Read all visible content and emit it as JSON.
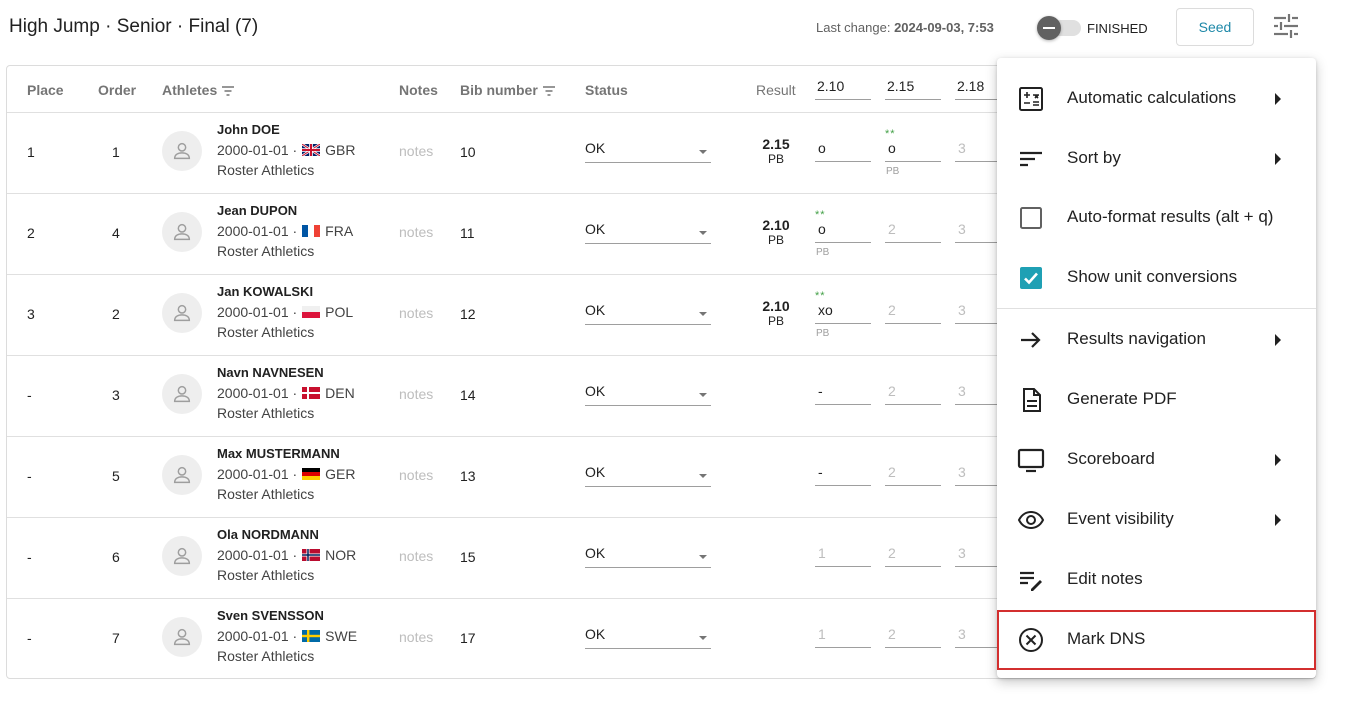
{
  "header": {
    "title": "High Jump · Senior · Final (7)",
    "last_change_label": "Last change:",
    "last_change_value": "2024-09-03, 7:53",
    "finished_label": "FINISHED",
    "seed_label": "Seed"
  },
  "table": {
    "headers": {
      "place": "Place",
      "order": "Order",
      "athletes": "Athletes",
      "notes": "Notes",
      "bib": "Bib number",
      "status": "Status",
      "result": "Result"
    },
    "heights": [
      "2.10",
      "2.15",
      "2.18"
    ],
    "rows": [
      {
        "place": "1",
        "order": "1",
        "name": "John DOE",
        "dob": "2000-01-01 ·",
        "country": "GBR",
        "club": "Roster Athletics",
        "notes": "notes",
        "bib": "10",
        "status": "OK",
        "result": "2.15",
        "result_pb": "PB",
        "a1": "o",
        "a1_stars": "",
        "a1_pb": "",
        "a2": "o",
        "a2_stars": "**",
        "a2_pb": "PB",
        "a3": "3"
      },
      {
        "place": "2",
        "order": "4",
        "name": "Jean DUPON",
        "dob": "2000-01-01 ·",
        "country": "FRA",
        "club": "Roster Athletics",
        "notes": "notes",
        "bib": "11",
        "status": "OK",
        "result": "2.10",
        "result_pb": "PB",
        "a1": "o",
        "a1_stars": "**",
        "a1_pb": "PB",
        "a2": "2",
        "a2_stars": "",
        "a2_pb": "",
        "a3": "3"
      },
      {
        "place": "3",
        "order": "2",
        "name": "Jan KOWALSKI",
        "dob": "2000-01-01 ·",
        "country": "POL",
        "club": "Roster Athletics",
        "notes": "notes",
        "bib": "12",
        "status": "OK",
        "result": "2.10",
        "result_pb": "PB",
        "a1": "xo",
        "a1_stars": "**",
        "a1_pb": "PB",
        "a2": "2",
        "a2_stars": "",
        "a2_pb": "",
        "a3": "3"
      },
      {
        "place": "-",
        "order": "3",
        "name": "Navn NAVNESEN",
        "dob": "2000-01-01 ·",
        "country": "DEN",
        "club": "Roster Athletics",
        "notes": "notes",
        "bib": "14",
        "status": "OK",
        "result": "",
        "result_pb": "",
        "a1": "-",
        "a1_stars": "",
        "a1_pb": "",
        "a2": "2",
        "a2_stars": "",
        "a2_pb": "",
        "a3": "3"
      },
      {
        "place": "-",
        "order": "5",
        "name": "Max MUSTERMANN",
        "dob": "2000-01-01 ·",
        "country": "GER",
        "club": "Roster Athletics",
        "notes": "notes",
        "bib": "13",
        "status": "OK",
        "result": "",
        "result_pb": "",
        "a1": "-",
        "a1_stars": "",
        "a1_pb": "",
        "a2": "2",
        "a2_stars": "",
        "a2_pb": "",
        "a3": "3"
      },
      {
        "place": "-",
        "order": "6",
        "name": "Ola NORDMANN",
        "dob": "2000-01-01 ·",
        "country": "NOR",
        "club": "Roster Athletics",
        "notes": "notes",
        "bib": "15",
        "status": "OK",
        "result": "",
        "result_pb": "",
        "a1": "1",
        "a1_stars": "",
        "a1_pb": "",
        "a2": "2",
        "a2_stars": "",
        "a2_pb": "",
        "a3": "3"
      },
      {
        "place": "-",
        "order": "7",
        "name": "Sven SVENSSON",
        "dob": "2000-01-01 ·",
        "country": "SWE",
        "club": "Roster Athletics",
        "notes": "notes",
        "bib": "17",
        "status": "OK",
        "result": "",
        "result_pb": "",
        "a1": "1",
        "a1_stars": "",
        "a1_pb": "",
        "a2": "2",
        "a2_stars": "",
        "a2_pb": "",
        "a3": "3"
      }
    ]
  },
  "menu": {
    "items": [
      {
        "label": "Automatic calculations",
        "icon": "calculator-icon",
        "submenu": true
      },
      {
        "label": "Sort by",
        "icon": "sort-icon",
        "submenu": true
      },
      {
        "label": "Auto-format results (alt + q)",
        "icon": "checkbox-unchecked-icon",
        "submenu": false
      },
      {
        "label": "Show unit conversions",
        "icon": "checkbox-checked-icon",
        "submenu": false
      },
      {
        "label": "Results navigation",
        "icon": "arrow-right-icon",
        "submenu": true
      },
      {
        "label": "Generate PDF",
        "icon": "document-icon",
        "submenu": false
      },
      {
        "label": "Scoreboard",
        "icon": "monitor-icon",
        "submenu": true
      },
      {
        "label": "Event visibility",
        "icon": "eye-icon",
        "submenu": true
      },
      {
        "label": "Edit notes",
        "icon": "edit-notes-icon",
        "submenu": false
      },
      {
        "label": "Mark DNS",
        "icon": "cancel-circle-icon",
        "submenu": false
      }
    ]
  },
  "colors": {
    "accent": "#1e88a8",
    "checkbox": "#1fa0b4",
    "highlight": "#d32f2f",
    "pb_stars": "#43a047"
  }
}
